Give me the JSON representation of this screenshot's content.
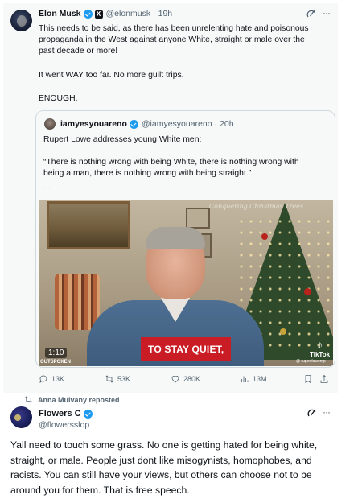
{
  "main_tweet": {
    "name": "Elon Musk",
    "handle": "@elonmusk",
    "sep": "·",
    "time": "19h",
    "lines": [
      "This needs to be said, as there has been unrelenting hate and poisonous",
      "propaganda in the West against anyone White, straight or male over the",
      "past decade or more!"
    ],
    "line2": "It went WAY too far. No more guilt trips.",
    "line3": "ENOUGH."
  },
  "quote": {
    "name": "iamyesyouareno",
    "handle": "@iamyesyouareno",
    "sep": "·",
    "time": "20h",
    "intro": "Rupert Lowe addresses young White men:",
    "quote_lines": [
      "“There is nothing wrong with being White, there is nothing wrong with",
      "being a man, there is nothing wrong with being straight.”"
    ],
    "ellipsis": "...",
    "video": {
      "caption": "TO STAY QUIET,",
      "duration": "1:10",
      "brand": "OUTSPOKEN",
      "tiktok_label": "TikTok",
      "tiktok_user": "@ rupertlowemp",
      "watermark": "Conquering Christmas Trees"
    }
  },
  "actions": {
    "replies": "13K",
    "reposts": "53K",
    "likes": "280K",
    "views": "13M"
  },
  "repost_banner": "Anna Mulvany reposted",
  "reply_tweet": {
    "name": "Flowers C",
    "handle": "@flowersslop",
    "body_lines": [
      "Yall need to touch some grass. No one is getting hated for being white,",
      "straight, or male. People just dont like misogynists, homophobes, and",
      "racists. You can still have your views, but others can choose not to be",
      "around you for them. That is free speech."
    ]
  },
  "more_icon": "···",
  "colors": {
    "verified": "#1d9bf0",
    "caption_red": "#ca1c24",
    "muted": "#536471"
  }
}
